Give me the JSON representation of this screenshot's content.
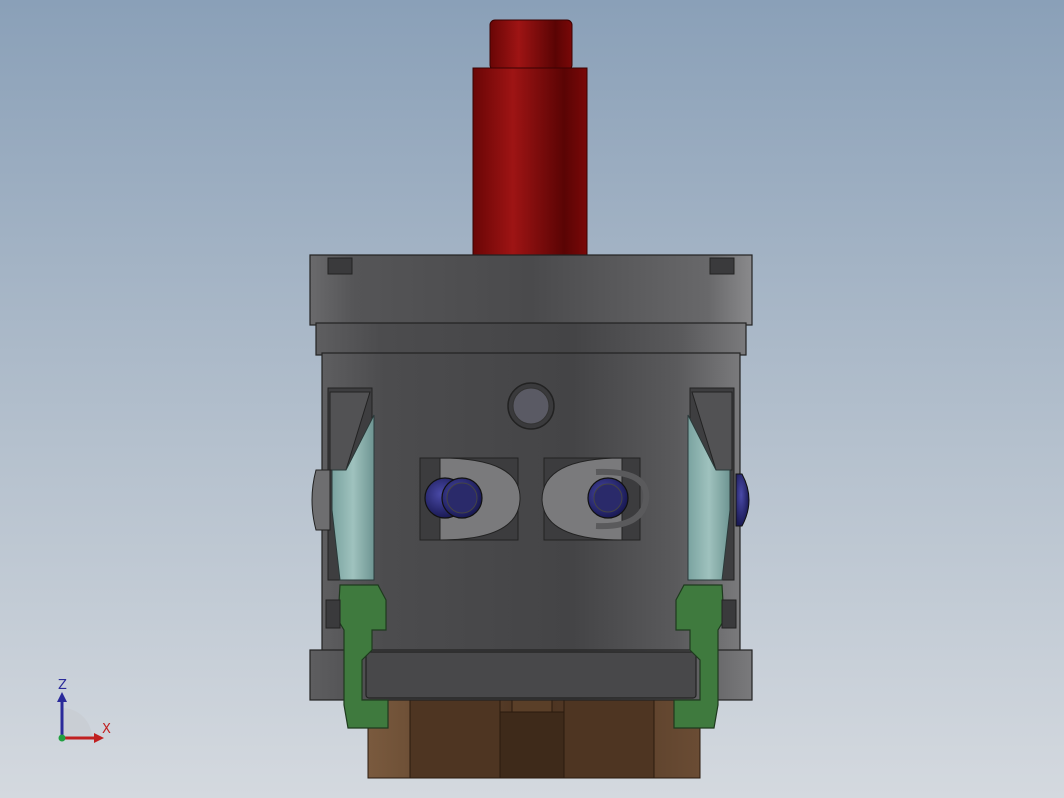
{
  "view": {
    "background_top": "#8aa0b8",
    "background_bottom": "#d4d9df"
  },
  "triad": {
    "z_label": "Z",
    "x_label": "X",
    "z_color": "#2a2a9a",
    "x_color": "#c02020",
    "y_color": "#20a040"
  },
  "parts": {
    "shaft": "red-shaft",
    "housing": "gray-housing",
    "clamps": "teal-clamps",
    "seals": "green-seals",
    "pins": "blue-pins",
    "base": "brown-base"
  },
  "colors": {
    "shaft": "#8a0a0a",
    "housing": "#4a4a4c",
    "clamp": "#8fb4b0",
    "seal": "#3f7a3e",
    "pin": "#2a2a78",
    "base": "#5a3f28"
  }
}
